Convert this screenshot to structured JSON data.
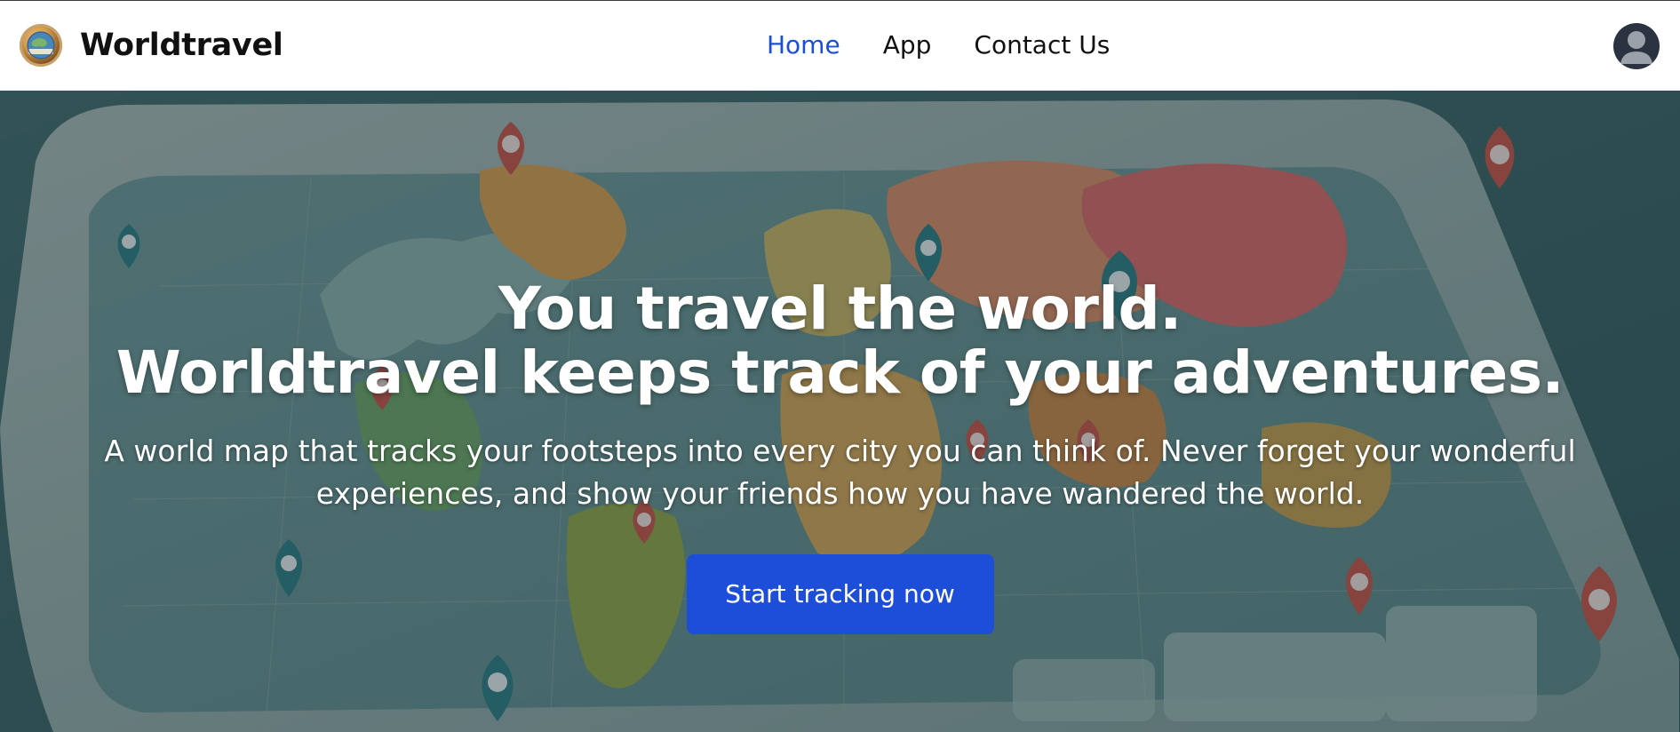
{
  "navbar": {
    "brand_name": "Worldtravel",
    "links": [
      {
        "label": "Home",
        "active": true
      },
      {
        "label": "App",
        "active": false
      },
      {
        "label": "Contact Us",
        "active": false
      }
    ],
    "avatar_icon": "user-avatar-icon"
  },
  "hero": {
    "title_line1": "You travel the world.",
    "title_line2": "Worldtravel keeps track of your adventures.",
    "subtitle": "A world map that tracks your footsteps into every city you can think of. Never forget your wonderful experiences, and show your friends how you have wandered the world.",
    "cta_label": "Start tracking now",
    "background_icon": "world-map-with-pins-image"
  },
  "colors": {
    "accent": "#1d4ed8",
    "text_dark": "#111111",
    "hero_text": "#ffffff"
  }
}
